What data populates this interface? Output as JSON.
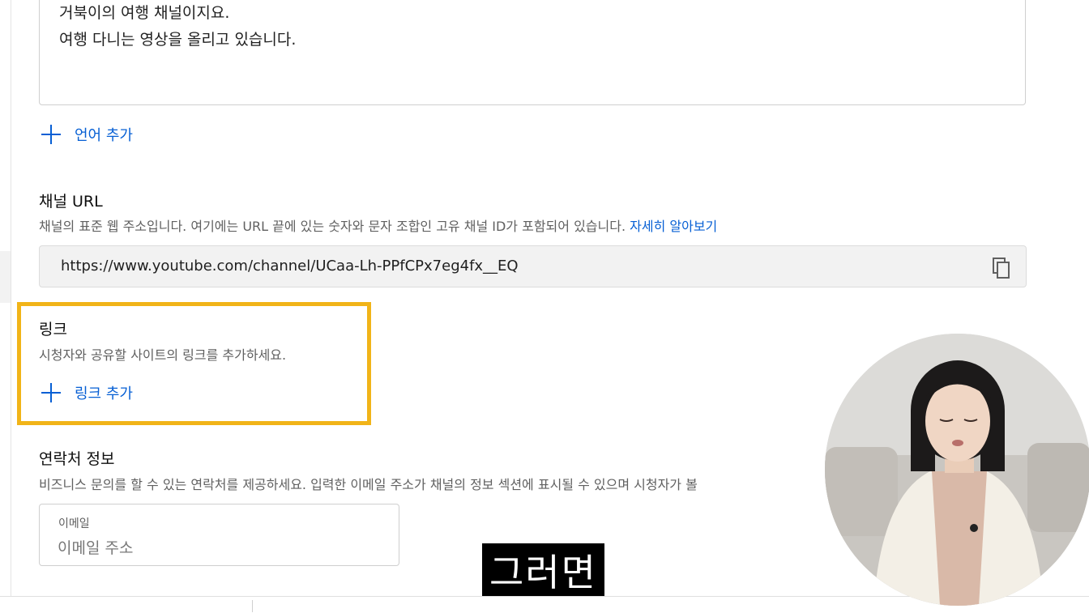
{
  "description": {
    "lines": [
      "거북이의 여행 채널이지요.",
      "여행 다니는 영상을 올리고 있습니다."
    ]
  },
  "add_language": {
    "label": "언어 추가"
  },
  "channel_url": {
    "title": "채널 URL",
    "description": "채널의 표준 웹 주소입니다. 여기에는 URL 끝에 있는 숫자와 문자 조합인 고유 채널 ID가 포함되어 있습니다.",
    "learn_more": "자세히 알아보기",
    "value": "https://www.youtube.com/channel/UCaa-Lh-PPfCPx7eg4fx__EQ"
  },
  "links": {
    "title": "링크",
    "description": "시청자와 공유할 사이트의 링크를 추가하세요.",
    "add_label": "링크 추가"
  },
  "contact": {
    "title": "연락처 정보",
    "description": "비즈니스 문의를 할 수 있는 연락처를 제공하세요. 입력한 이메일 주소가 채널의 정보 섹션에 표시될 수 있으며 시청자가 볼",
    "email_label": "이메일",
    "email_placeholder": "이메일 주소"
  },
  "subtitle": "그러면",
  "colors": {
    "accent": "#065fd4",
    "highlight": "#f1b418",
    "secondary_text": "#606060"
  },
  "icons": {
    "plus": "plus-icon",
    "copy": "copy-icon"
  }
}
